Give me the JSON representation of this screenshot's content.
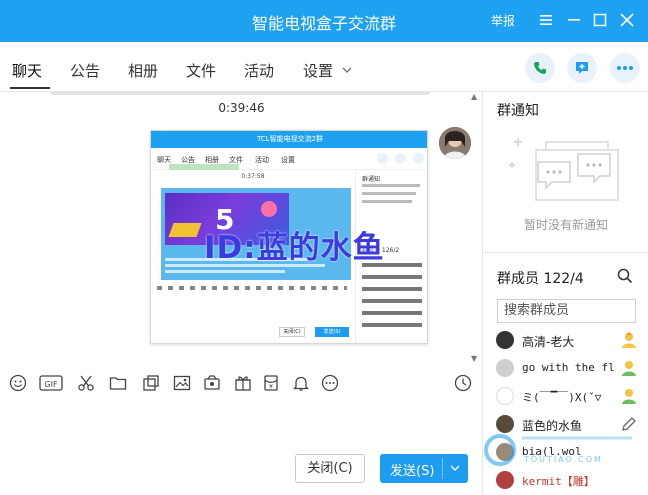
{
  "window": {
    "title": "智能电视盒子交流群",
    "report_label": "举报"
  },
  "tabs": [
    {
      "label": "聊天"
    },
    {
      "label": "公告"
    },
    {
      "label": "相册"
    },
    {
      "label": "文件"
    },
    {
      "label": "活动"
    },
    {
      "label": "设置"
    }
  ],
  "chat": {
    "timestamp": "0:39:46",
    "watermark": "ID:蓝的水鱼",
    "shared_screenshot": {
      "title": "TCL智能电视交流2群",
      "tabs": [
        "聊天",
        "公告",
        "相册",
        "文件",
        "活动",
        "设置"
      ],
      "timestamp": "0:37:58",
      "banner_digit": "5",
      "side_notice_title": "群通知",
      "side_members_title": "群成员 126/2",
      "close_label": "关闭(C)",
      "send_label": "发送(S)"
    }
  },
  "input": {
    "close_label": "关闭(C)",
    "send_label": "发送(S)"
  },
  "sidebar": {
    "notice_title": "群通知",
    "notice_empty_text": "暂时没有新通知",
    "members_title": "群成员 122/4",
    "search_placeholder": "搜索群成员",
    "members": [
      {
        "name": "高清-老大"
      },
      {
        "name": "go with the fl"
      },
      {
        "name": "ミ(￣▔￣)X(ˇ▽"
      },
      {
        "name": "蓝色的水鱼"
      },
      {
        "name": "bia(l.wol"
      },
      {
        "name": "kermit【雕】"
      }
    ],
    "watermark_brand": "TOUTIAO.COM"
  },
  "colors": {
    "accent": "#1ea1f0",
    "send": "#1e9cef"
  }
}
